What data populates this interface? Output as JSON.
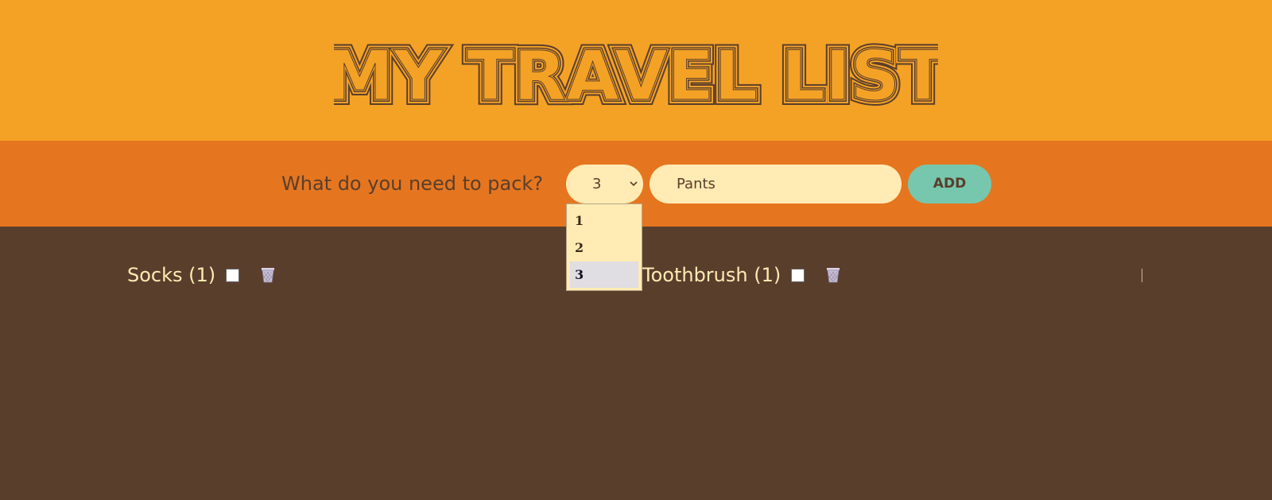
{
  "header": {
    "title": "MY TRAVEL LIST"
  },
  "form": {
    "prompt": "What do you need to pack?",
    "quantity": {
      "selected": "3",
      "options": [
        "1",
        "2",
        "3"
      ]
    },
    "item_input": {
      "value": "Pants"
    },
    "add_label": "ADD"
  },
  "items": [
    {
      "label": "Socks (1)",
      "packed": false
    },
    {
      "label": "Toothbrush (1)",
      "packed": false
    }
  ],
  "colors": {
    "header_bg": "#f4a226",
    "form_bg": "#e5761f",
    "list_bg": "#5a3e2c",
    "input_bg": "#ffebb3",
    "add_button_bg": "#76c7ad",
    "text_dark": "#5a3e2c",
    "text_light": "#ffebb3"
  },
  "icons": {
    "quantity_chevron": "chevron-down-icon",
    "delete": "trash-icon"
  }
}
